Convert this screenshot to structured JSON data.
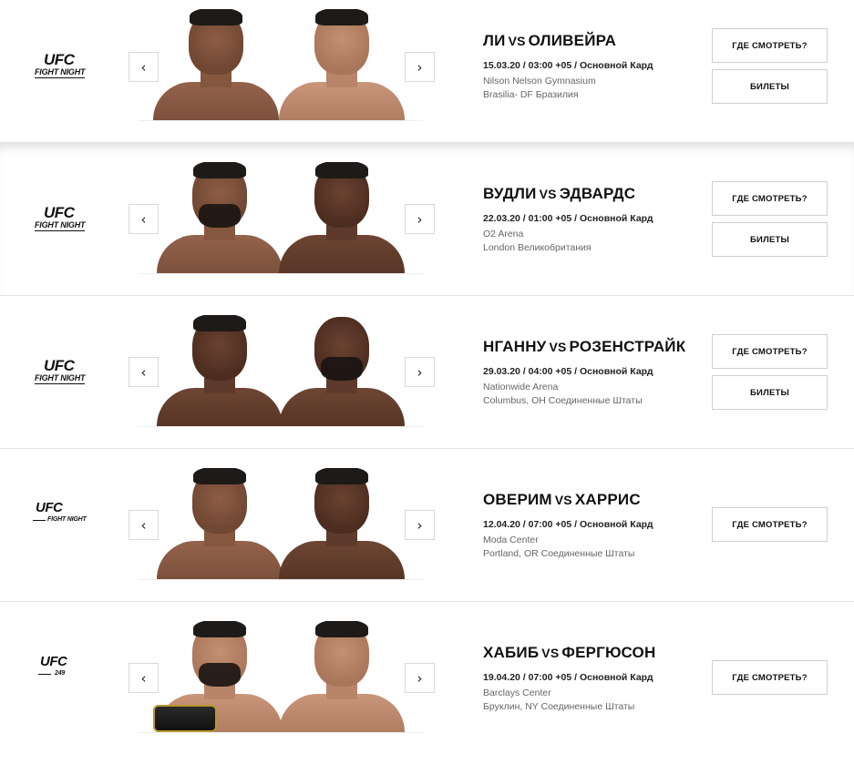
{
  "icons": {
    "prev": "chevron-left-icon",
    "next": "chevron-right-icon"
  },
  "arrows": {
    "prev": "‹",
    "next": "›"
  },
  "vs": "VS",
  "buttons": {
    "watch": "ГДЕ СМОТРЕТЬ?",
    "tickets": "БИЛЕТЫ"
  },
  "events": [
    {
      "logo": {
        "brand": "UFC",
        "sub": "FIGHT NIGHT"
      },
      "fighter1": "ЛИ",
      "fighter2": "ОЛИВЕЙРА",
      "date": "15.03.20 / 03:00 +05 / Основной Кард",
      "venue": "Nilson Nelson Gymnasium",
      "city": "Brasilia- DF Бразилия"
    },
    {
      "logo": {
        "brand": "UFC",
        "sub": "FIGHT NIGHT"
      },
      "fighter1": "ВУДЛИ",
      "fighter2": "ЭДВАРДС",
      "date": "22.03.20 / 01:00 +05 / Основной Кард",
      "venue": "O2 Arena",
      "city": "London Великобритания"
    },
    {
      "logo": {
        "brand": "UFC",
        "sub": "FIGHT NIGHT"
      },
      "fighter1": "НГАННУ",
      "fighter2": "РОЗЕНСТРАЙК",
      "date": "29.03.20 / 04:00 +05 / Основной Кард",
      "venue": "Nationwide Arena",
      "city": "Columbus, OH Соединенные Штаты"
    },
    {
      "logo": {
        "brand": "UFC",
        "sub": "FIGHT NIGHT"
      },
      "fighter1": "ОВЕРИМ",
      "fighter2": "ХАРРИС",
      "date": "12.04.20 / 07:00 +05 / Основной Кард",
      "venue": "Moda Center",
      "city": "Portland, OR Соединенные Штаты"
    },
    {
      "logo": {
        "brand": "UFC",
        "sub": "249"
      },
      "fighter1": "ХАБИБ",
      "fighter2": "ФЕРГЮСОН",
      "date": "19.04.20 / 07:00 +05 / Основной Кард",
      "venue": "Barclays Center",
      "city": "Бруклин, NY Соединенные Штаты"
    }
  ]
}
